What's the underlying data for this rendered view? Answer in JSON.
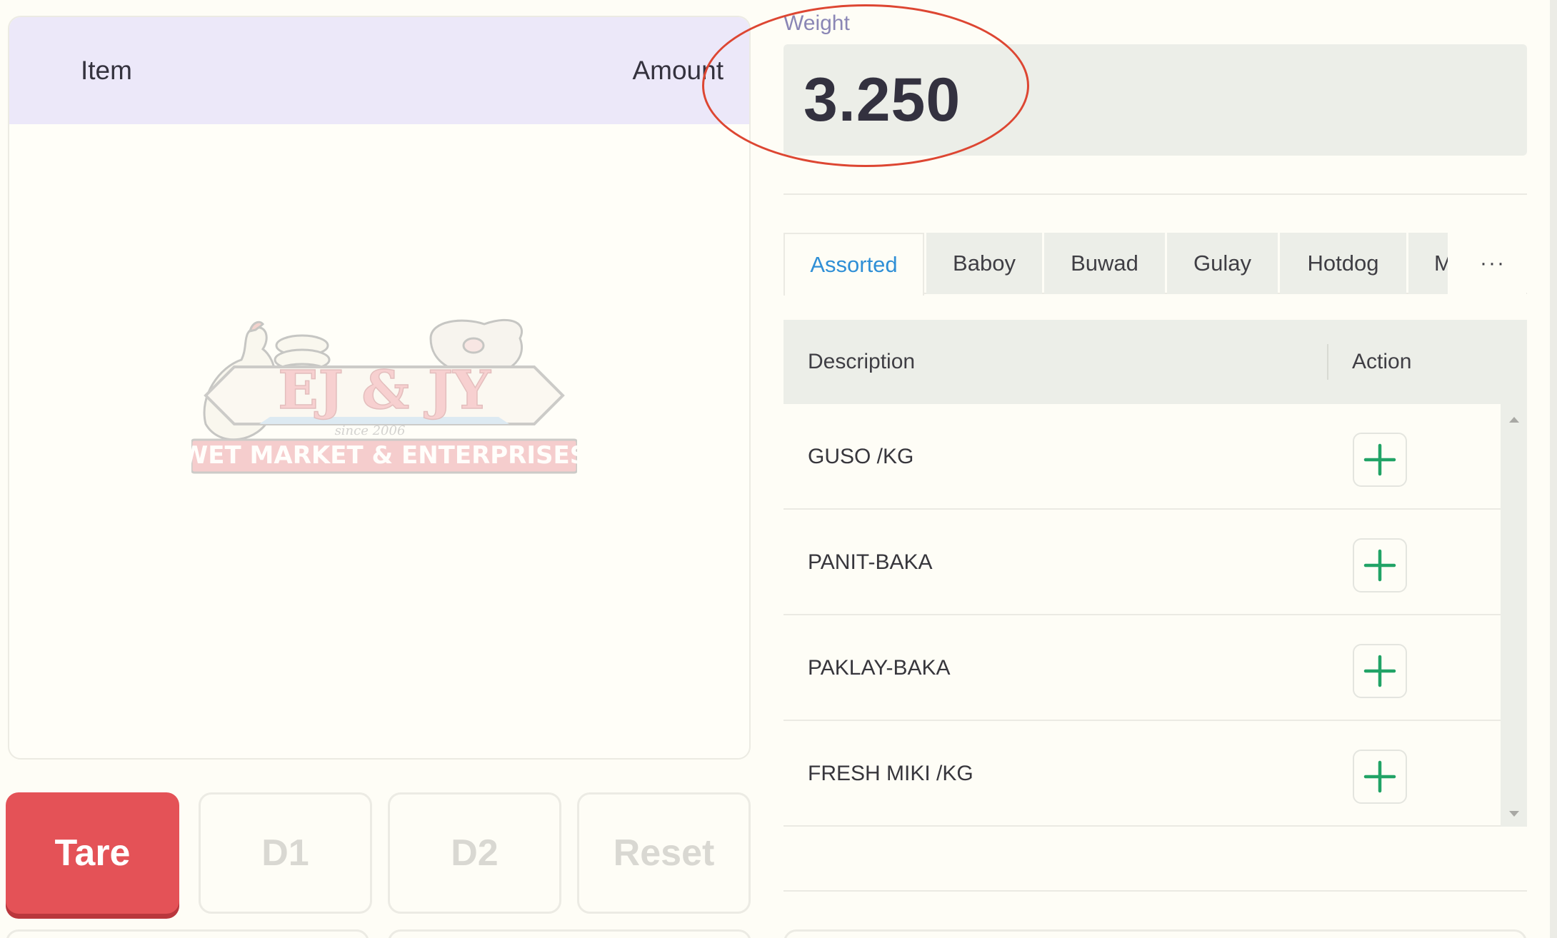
{
  "order": {
    "col_item": "Item",
    "col_amount": "Amount",
    "logo": {
      "brand": "EJ & JY",
      "since": "since 2006",
      "tagline": "WET MARKET & ENTERPRISES"
    }
  },
  "keypad": {
    "tare": "Tare",
    "d1": "D1",
    "d2": "D2",
    "reset": "Reset"
  },
  "weight": {
    "label": "Weight",
    "value": "3.250"
  },
  "tabs": {
    "items": [
      {
        "label": "Assorted",
        "active": true
      },
      {
        "label": "Baboy"
      },
      {
        "label": "Buwad"
      },
      {
        "label": "Gulay"
      },
      {
        "label": "Hotdog"
      },
      {
        "label": "M"
      }
    ],
    "more": "···"
  },
  "products": {
    "col_description": "Description",
    "col_action": "Action",
    "rows": [
      {
        "description": "GUSO /KG"
      },
      {
        "description": "PANIT-BAKA"
      },
      {
        "description": "PAKLAY-BAKA"
      },
      {
        "description": "FRESH MIKI /KG"
      }
    ]
  },
  "colors": {
    "tare_red": "#e45257",
    "weight_bg": "#eceee8",
    "header_lavender": "#ece8f9",
    "active_tab_blue": "#2f8fd6",
    "add_green": "#21a366",
    "highlight_circle": "#dd4632"
  },
  "icons": {
    "add": "plus-icon",
    "tab_overflow": "ellipsis-icon"
  }
}
